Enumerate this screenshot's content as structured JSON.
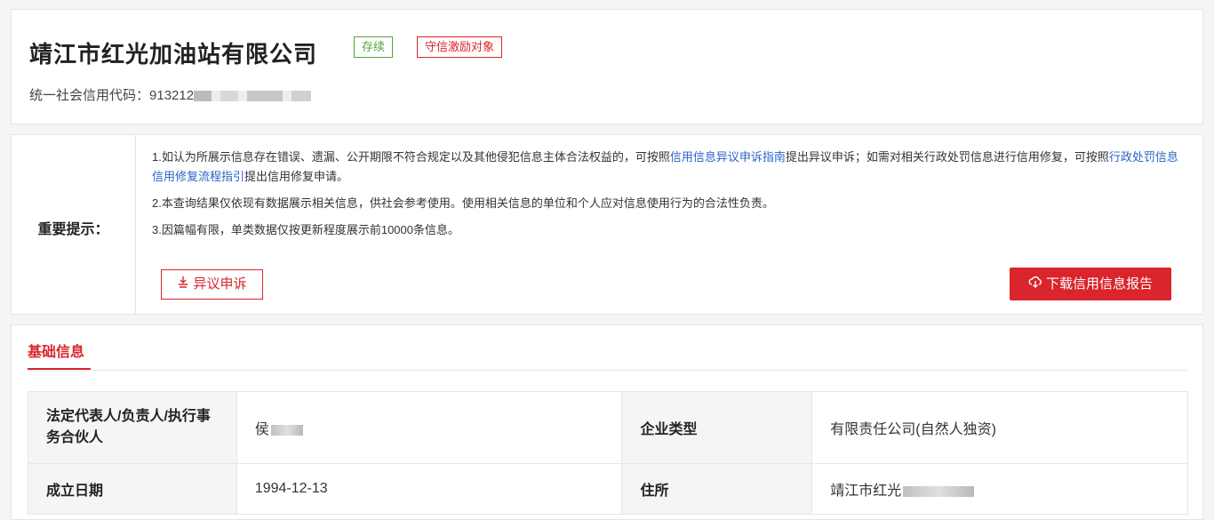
{
  "company": {
    "name": "靖江市红光加油站有限公司",
    "tags": [
      "存续",
      "守信激励对象"
    ],
    "credit_label": "统一社会信用代码：",
    "credit_code_visible": "913212"
  },
  "notice": {
    "title": "重要提示：",
    "p1_a": "1.如认为所展示信息存在错误、遗漏、公开期限不符合规定以及其他侵犯信息主体合法权益的，可按照",
    "p1_link1": "信用信息异议申诉指南",
    "p1_b": "提出异议申诉；如需对相关行政处罚信息进行信用修复，可按照",
    "p1_link2": "行政处罚信息信用修复流程指引",
    "p1_c": "提出信用修复申请。",
    "p2": "2.本查询结果仅依现有数据展示相关信息，供社会参考使用。使用相关信息的单位和个人应对信息使用行为的合法性负责。",
    "p3": "3.因篇幅有限，单类数据仅按更新程度展示前10000条信息。",
    "appeal_button": "异议申诉",
    "download_button": "下载信用信息报告"
  },
  "basic": {
    "section_title": "基础信息",
    "rows": [
      {
        "label1": "法定代表人/负责人/执行事务合伙人",
        "value1": "侯",
        "label2": "企业类型",
        "value2": "有限责任公司(自然人独资)"
      },
      {
        "label1": "成立日期",
        "value1": "1994-12-13",
        "label2": "住所",
        "value2": "靖江市红光"
      }
    ]
  }
}
